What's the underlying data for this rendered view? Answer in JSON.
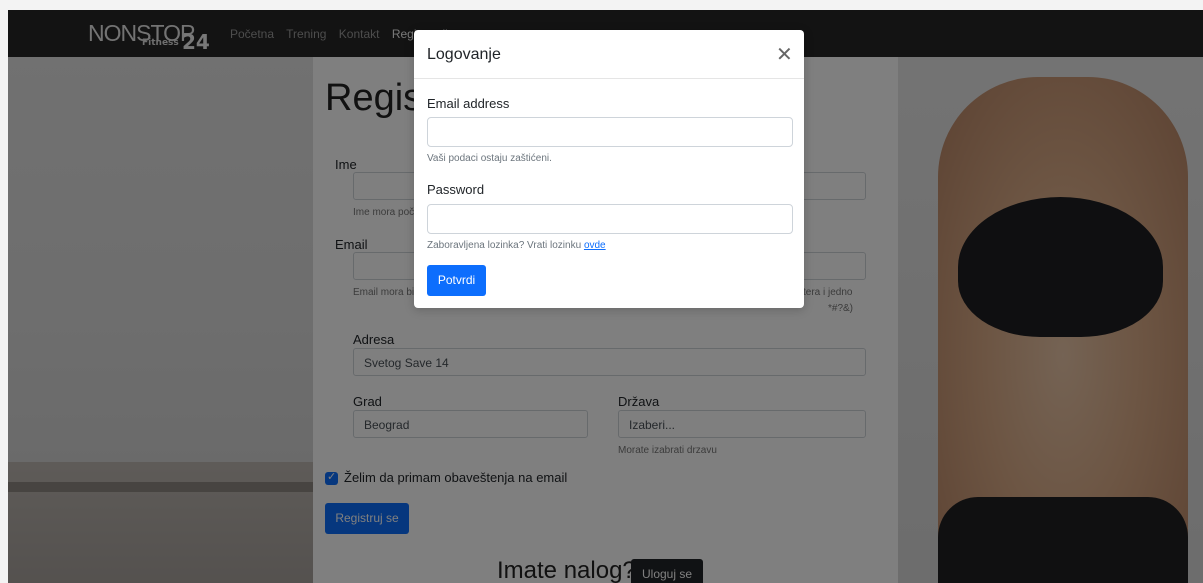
{
  "navbar": {
    "logo": {
      "brand": "NONSTOP",
      "sub": "Fitness",
      "num": "24"
    },
    "links": [
      "Početna",
      "Trening",
      "Kontakt",
      "Registracija"
    ]
  },
  "register": {
    "title": "Registracija",
    "first_name_label": "Ime",
    "first_name_hint": "Ime mora počinjati velikim slovom",
    "email_label": "Email",
    "email_hint": "Email mora biti validan",
    "password_hint_1": "tera i jedno",
    "password_hint_2": "*#?&)",
    "address_label": "Adresa",
    "address_value": "Svetog Save 14",
    "city_label": "Grad",
    "city_placeholder": "Beograd",
    "country_label": "Država",
    "country_selected": "Izaberi...",
    "country_hint": "Morate izabrati drzavu",
    "newsletter_label": "Želim da primam obaveštenja na email",
    "register_button": "Registruj se",
    "have_account": "Imate nalog?",
    "login_button": "Uloguj se"
  },
  "modal": {
    "title": "Logovanje",
    "email_label": "Email address",
    "email_hint": "Vaši podaci ostaju zaštićeni.",
    "password_label": "Password",
    "forgot_text": "Zaboravljena lozinka? Vrati lozinku",
    "forgot_link": "ovde",
    "submit_button": "Potvrdi"
  }
}
